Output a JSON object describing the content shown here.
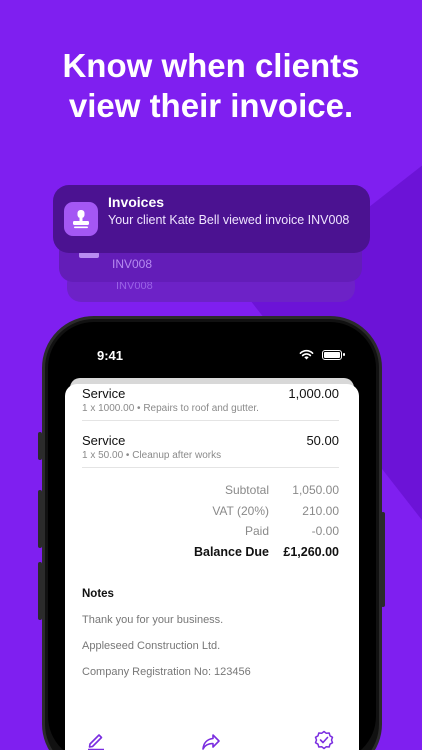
{
  "headline": {
    "line1": "Know when clients",
    "line2": "view their invoice."
  },
  "notification": {
    "app_icon": "stamp-icon",
    "title": "Invoices",
    "body": "Your client Kate Bell viewed invoice INV008",
    "stacked_1": "INV008",
    "stacked_2": "INV008"
  },
  "status_bar": {
    "time": "9:41",
    "icons": [
      "wifi-icon",
      "battery-icon"
    ]
  },
  "invoice": {
    "items": [
      {
        "name": "Service",
        "description": "1 x 1000.00 • Repairs to roof and gutter.",
        "amount": "1,000.00"
      },
      {
        "name": "Service",
        "description": "1 x 50.00 • Cleanup after works",
        "amount": "50.00"
      }
    ],
    "totals": [
      {
        "label": "Subtotal",
        "value": "1,050.00"
      },
      {
        "label": "VAT (20%)",
        "value": "210.00"
      },
      {
        "label": "Paid",
        "value": "-0.00"
      },
      {
        "label": "Balance Due",
        "value": "£1,260.00"
      }
    ],
    "notes": {
      "title": "Notes",
      "lines": [
        "Thank you for your business.",
        "Appleseed Construction Ltd.",
        "Company Registration No: 123456"
      ]
    }
  },
  "toolbar": {
    "icons": [
      "edit-icon",
      "share-icon",
      "mark-paid-icon"
    ]
  },
  "colors": {
    "background": "#7f1ff0",
    "notification": "#4b1291",
    "accent": "#7a2de0"
  }
}
